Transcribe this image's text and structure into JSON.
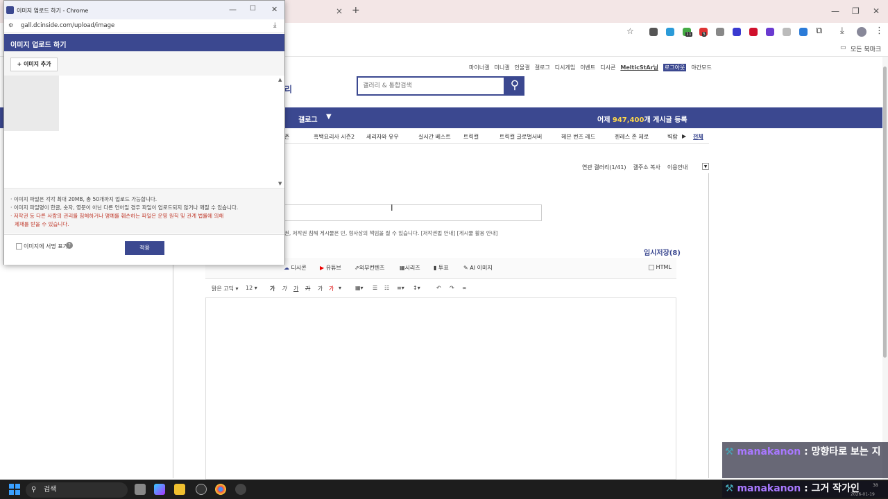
{
  "browser": {
    "new_tab": "+",
    "tab_close": "×",
    "window_minimize": "—",
    "window_restore": "❐",
    "window_close": "✕",
    "bookmark_label": "모든 북마크",
    "extension_badges": [
      "11",
      "5"
    ]
  },
  "site": {
    "utility_links": [
      "마이너갤",
      "미니갤",
      "인물갤",
      "갤로그",
      "디시게임",
      "이벤트",
      "디시콘",
      "MelticStAr님",
      "로그아웃",
      "야간모드"
    ],
    "search_placeholder": "갤러리 & 통합검색",
    "title_fragment": "리",
    "nav_label": "갤로그",
    "post_count_prefix": "어제 ",
    "post_count_value": "947,400",
    "post_count_suffix": "개 게시글 등록",
    "gallery_tabs": [
      "존",
      "흑백요리사 시즌2",
      "세리자와 유우",
      "실시간 베스트",
      "트릭컬",
      "트릭컬 글로벌서버",
      "헤븐 번즈 레드",
      "젠레스 존 제로",
      "벽람"
    ],
    "tabs_all": "전체",
    "related_gallery": "연관 갤러리(1/41)",
    "copy_address": "갤주소 복사",
    "usage_guide": "이용안내",
    "copyright_notice": "권, 저작권 침해 게시물은 민, 형사상의 책임을 질 수 있습니다. [저작권법 안내] [게시물 활용 안내]",
    "temp_save": "임시저장(8)"
  },
  "editor": {
    "toolbar1": [
      "디시콘",
      "유튜브",
      "외부컨텐츠",
      "시리즈",
      "투표",
      "AI 이미지"
    ],
    "html_label": "HTML",
    "font_name": "맑은 고딕",
    "font_size": "12",
    "format_buttons": [
      "가",
      "가",
      "가",
      "가",
      "가",
      "가"
    ]
  },
  "popup": {
    "window_title": "이미지 업로드 하기 - Chrome",
    "url": "gall.dcinside.com/upload/image",
    "header": "이미지 업로드 하기",
    "add_button": "+ 이미지 추가",
    "notes": [
      "이미지 파일은 각각 최대 20MB, 총 50개까지 업로드 가능합니다.",
      "이미지 파일명이 한글, 숫자, 영문이 아닌 다른 언어일 경우 파일이 업로드되지 않거나 깨질 수 있습니다."
    ],
    "warning_line1": "저작권 등 다른 사람의 권리를 침해하거나 명예를 훼손하는 파일은 운영 원칙 및 관계 법률에 의해",
    "warning_line2": "제재를 받을 수 있습니다.",
    "signature_checkbox": "이미지에 서명 표기",
    "apply_button": "적용"
  },
  "taskbar": {
    "search_placeholder": "검색",
    "clock_time": "38",
    "clock_date": "2026-01-19"
  },
  "chat": [
    {
      "user": "manakanon",
      "message": ": 망향타로 보는 지"
    },
    {
      "user": "manakanon",
      "message": ": 그거 작가인"
    }
  ],
  "colors": {
    "brand": "#3b4890",
    "warning": "#c0392b"
  }
}
